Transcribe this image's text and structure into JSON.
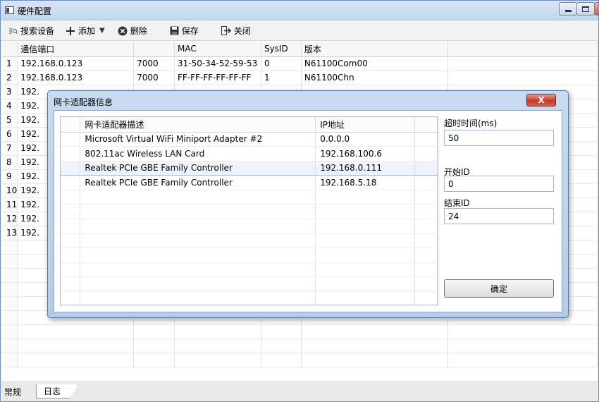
{
  "window": {
    "title": "硬件配置"
  },
  "toolbar": {
    "search_label": "搜索设备",
    "add_label": "添加",
    "delete_label": "删除",
    "save_label": "保存",
    "close_label": "关闭"
  },
  "table": {
    "columns": [
      "",
      "通信端口",
      "",
      "MAC",
      "SysID",
      "版本",
      ""
    ],
    "rows": [
      [
        "1",
        "192.168.0.123",
        "7000",
        "31-50-34-52-59-53",
        "0",
        "N61100Com00"
      ],
      [
        "2",
        "192.168.0.123",
        "7000",
        "FF-FF-FF-FF-FF-FF",
        "1",
        "N61100Chn"
      ],
      [
        "3",
        "192.",
        "",
        "",
        "",
        ""
      ],
      [
        "4",
        "192.",
        "",
        "",
        "",
        ""
      ],
      [
        "5",
        "192.",
        "",
        "",
        "",
        ""
      ],
      [
        "6",
        "192.",
        "",
        "",
        "",
        ""
      ],
      [
        "7",
        "192.",
        "",
        "",
        "",
        ""
      ],
      [
        "8",
        "192.",
        "",
        "",
        "",
        ""
      ],
      [
        "9",
        "192.",
        "",
        "",
        "",
        ""
      ],
      [
        "10",
        "192.",
        "",
        "",
        "",
        ""
      ],
      [
        "11",
        "192.",
        "",
        "",
        "",
        ""
      ],
      [
        "12",
        "192.",
        "",
        "",
        "",
        ""
      ],
      [
        "13",
        "192.",
        "",
        "",
        "",
        ""
      ]
    ]
  },
  "tabs": {
    "general": "常规",
    "log": "日志"
  },
  "dialog": {
    "title": "网卡适配器信息",
    "close_label": "X",
    "columns": {
      "desc": "网卡适配器描述",
      "ip": "IP地址"
    },
    "adapters": [
      {
        "desc": "Microsoft Virtual WiFi Miniport Adapter #2",
        "ip": "0.0.0.0"
      },
      {
        "desc": "802.11ac Wireless LAN Card",
        "ip": "192.168.100.6"
      },
      {
        "desc": "Realtek PCIe GBE Family Controller",
        "ip": "192.168.0.111"
      },
      {
        "desc": "Realtek PCIe GBE Family Controller",
        "ip": "192.168.5.18"
      }
    ],
    "selected_index": 2,
    "timeout_label": "超时时间(ms)",
    "timeout_value": "50",
    "start_id_label": "开始ID",
    "start_id_value": "0",
    "end_id_label": "结束ID",
    "end_id_value": "24",
    "ok_label": "确定"
  },
  "colors": {
    "selection": "#eef4fb",
    "title_bar": "#c4d7ef",
    "dialog_frame": "#b6cbe6",
    "close_red": "#c0392b"
  },
  "icons": [
    "app-icon",
    "search-icon",
    "plus-icon",
    "dropdown-arrow-icon",
    "delete-icon",
    "save-icon",
    "exit-icon",
    "minimize-icon",
    "maximize-icon",
    "close-icon"
  ]
}
